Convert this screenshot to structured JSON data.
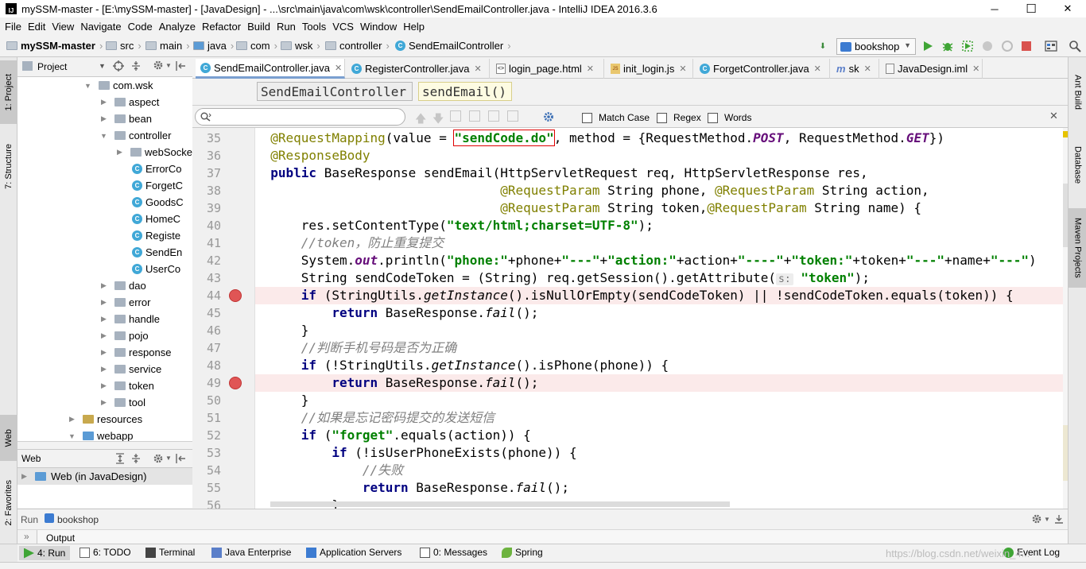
{
  "window": {
    "title": "mySSM-master - [E:\\mySSM-master] - [JavaDesign] - ...\\src\\main\\java\\com\\wsk\\controller\\SendEmailController.java - IntelliJ IDEA 2016.3.6",
    "minimize": "─",
    "maximize": "☐",
    "close": "✕"
  },
  "menu": [
    "File",
    "Edit",
    "View",
    "Navigate",
    "Code",
    "Analyze",
    "Refactor",
    "Build",
    "Run",
    "Tools",
    "VCS",
    "Window",
    "Help"
  ],
  "breadcrumb": [
    "mySSM-master",
    "src",
    "main",
    "java",
    "com",
    "wsk",
    "controller",
    "SendEmailController"
  ],
  "run_config": "bookshop",
  "project_panel": {
    "title": "Project",
    "tree": [
      {
        "label": "com.wsk",
        "depth": 0,
        "kind": "package",
        "expanded": true
      },
      {
        "label": "aspect",
        "depth": 1,
        "kind": "package",
        "expanded": false
      },
      {
        "label": "bean",
        "depth": 1,
        "kind": "package",
        "expanded": false
      },
      {
        "label": "controller",
        "depth": 1,
        "kind": "package",
        "expanded": true
      },
      {
        "label": "webSocke",
        "depth": 2,
        "kind": "package",
        "expanded": false
      },
      {
        "label": "ErrorCo",
        "depth": 2,
        "kind": "class"
      },
      {
        "label": "ForgetC",
        "depth": 2,
        "kind": "class"
      },
      {
        "label": "GoodsC",
        "depth": 2,
        "kind": "class"
      },
      {
        "label": "HomeC",
        "depth": 2,
        "kind": "class"
      },
      {
        "label": "Registe",
        "depth": 2,
        "kind": "class"
      },
      {
        "label": "SendEn",
        "depth": 2,
        "kind": "class"
      },
      {
        "label": "UserCo",
        "depth": 2,
        "kind": "class"
      },
      {
        "label": "dao",
        "depth": 1,
        "kind": "package",
        "expanded": false
      },
      {
        "label": "error",
        "depth": 1,
        "kind": "package",
        "expanded": false
      },
      {
        "label": "handle",
        "depth": 1,
        "kind": "package",
        "expanded": false
      },
      {
        "label": "pojo",
        "depth": 1,
        "kind": "package",
        "expanded": false
      },
      {
        "label": "response",
        "depth": 1,
        "kind": "package",
        "expanded": false
      },
      {
        "label": "service",
        "depth": 1,
        "kind": "package",
        "expanded": false
      },
      {
        "label": "token",
        "depth": 1,
        "kind": "package",
        "expanded": false
      },
      {
        "label": "tool",
        "depth": 1,
        "kind": "package",
        "expanded": false
      },
      {
        "label": "resources",
        "depth": -1,
        "kind": "folder",
        "expanded": false
      },
      {
        "label": "webapp",
        "depth": -1,
        "kind": "folder",
        "expanded": true
      }
    ]
  },
  "web_panel": {
    "title": "Web",
    "item": "Web (in JavaDesign)"
  },
  "editor_tabs": [
    {
      "label": "SendEmailController.java",
      "active": true,
      "icon": "class-icon"
    },
    {
      "label": "RegisterController.java",
      "active": false,
      "icon": "class-icon"
    },
    {
      "label": "login_page.html",
      "active": false,
      "icon": "html-icon"
    },
    {
      "label": "init_login.js",
      "active": false,
      "icon": "js-icon"
    },
    {
      "label": "ForgetController.java",
      "active": false,
      "icon": "class-icon"
    },
    {
      "label": "sk",
      "active": false,
      "icon": "file-icon"
    },
    {
      "label": "JavaDesign.iml",
      "active": false,
      "icon": "module-icon"
    }
  ],
  "structure_crumbs": [
    "SendEmailController",
    "sendEmail()"
  ],
  "find_bar": {
    "value": "",
    "options": [
      "Match Case",
      "Regex",
      "Words"
    ]
  },
  "code": {
    "line_numbers": [
      "35",
      "36",
      "37",
      "38",
      "39",
      "40",
      "41",
      "42",
      "43",
      "44",
      "45",
      "46",
      "47",
      "48",
      "49",
      "50",
      "51",
      "52",
      "53",
      "54",
      "55",
      "56"
    ],
    "breakpoints": [
      "44",
      "49"
    ],
    "lines": [
      [
        [
          "an",
          "@RequestMapping"
        ],
        [
          "",
          "(value = "
        ],
        [
          "st boxed",
          "\"sendCode.do\""
        ],
        [
          "",
          ", method = {RequestMethod."
        ],
        [
          "sf",
          "POST"
        ],
        [
          "",
          ", RequestMethod."
        ],
        [
          "sf",
          "GET"
        ],
        [
          "",
          "})"
        ]
      ],
      [
        [
          "an",
          "@ResponseBody"
        ]
      ],
      [
        [
          "kw",
          "public "
        ],
        [
          "",
          "BaseResponse sendEmail(HttpServletRequest req, HttpServletResponse res,"
        ]
      ],
      [
        [
          "",
          "                              "
        ],
        [
          "an",
          "@RequestParam "
        ],
        [
          "",
          "String phone, "
        ],
        [
          "an",
          "@RequestParam "
        ],
        [
          "",
          "String action,"
        ]
      ],
      [
        [
          "",
          "                              "
        ],
        [
          "an",
          "@RequestParam "
        ],
        [
          "",
          "String token,"
        ],
        [
          "an",
          "@RequestParam "
        ],
        [
          "",
          "String name) {"
        ]
      ],
      [
        [
          "",
          "    res.setContentType("
        ],
        [
          "st",
          "\"text/html;charset=UTF-8\""
        ],
        [
          "",
          ");"
        ]
      ],
      [
        [
          "cm",
          "    //token，防止重复提交"
        ]
      ],
      [
        [
          "",
          "    System."
        ],
        [
          "sf",
          "out"
        ],
        [
          "",
          ".println("
        ],
        [
          "st",
          "\"phone:\""
        ],
        [
          "",
          "+phone+"
        ],
        [
          "st",
          "\"---\""
        ],
        [
          "",
          "+"
        ],
        [
          "st",
          "\"action:\""
        ],
        [
          "",
          "+action+"
        ],
        [
          "st",
          "\"----\""
        ],
        [
          "",
          "+"
        ],
        [
          "st",
          "\"token:\""
        ],
        [
          "",
          "+token+"
        ],
        [
          "st",
          "\"---\""
        ],
        [
          "",
          "+name+"
        ],
        [
          "st",
          "\"---\""
        ],
        [
          "",
          ")"
        ]
      ],
      [
        [
          "",
          "    String sendCodeToken = (String) req.getSession().getAttribute("
        ],
        [
          "hint",
          "s:"
        ],
        [
          "st",
          " \"token\""
        ],
        [
          "",
          ");"
        ]
      ],
      [
        [
          "kw",
          "    if "
        ],
        [
          "",
          "(StringUtils."
        ],
        [
          "it",
          "getInstance"
        ],
        [
          "",
          "().isNullOrEmpty(sendCodeToken) || !sendCodeToken.equals(token)) {"
        ]
      ],
      [
        [
          "kw",
          "        return "
        ],
        [
          "",
          "BaseResponse."
        ],
        [
          "it",
          "fail"
        ],
        [
          "",
          "();"
        ]
      ],
      [
        [
          "",
          "    }"
        ]
      ],
      [
        [
          "cm",
          "    //判断手机号码是否为正确"
        ]
      ],
      [
        [
          "kw",
          "    if "
        ],
        [
          "",
          "(!StringUtils."
        ],
        [
          "it",
          "getInstance"
        ],
        [
          "",
          "().isPhone(phone)) {"
        ]
      ],
      [
        [
          "kw",
          "        return "
        ],
        [
          "",
          "BaseResponse."
        ],
        [
          "it",
          "fail"
        ],
        [
          "",
          "();"
        ]
      ],
      [
        [
          "",
          "    }"
        ]
      ],
      [
        [
          "cm",
          "    //如果是忘记密码提交的发送短信"
        ]
      ],
      [
        [
          "kw",
          "    if "
        ],
        [
          "",
          "("
        ],
        [
          "st",
          "\"forget\""
        ],
        [
          "",
          ".equals(action)) {"
        ]
      ],
      [
        [
          "kw",
          "        if "
        ],
        [
          "",
          "(!isUserPhoneExists(phone)) {"
        ]
      ],
      [
        [
          "cm",
          "            //失败"
        ]
      ],
      [
        [
          "kw",
          "            return "
        ],
        [
          "",
          "BaseResponse."
        ],
        [
          "it",
          "fail"
        ],
        [
          "",
          "();"
        ]
      ],
      [
        [
          "",
          "        }"
        ]
      ]
    ]
  },
  "left_stripe": [
    "1: Project",
    "7: Structure",
    "Web",
    "2: Favorites"
  ],
  "right_stripe": [
    "Ant Build",
    "Database",
    "Maven Projects"
  ],
  "run_panel": {
    "title": "Run",
    "config": "bookshop",
    "output_label": "Output"
  },
  "tool_windows": [
    "4: Run",
    "6: TODO",
    "Terminal",
    "Java Enterprise",
    "Application Servers",
    "0: Messages",
    "Spring",
    "Event Log"
  ],
  "watermark": "https://blog.csdn.net/weixin_4..."
}
